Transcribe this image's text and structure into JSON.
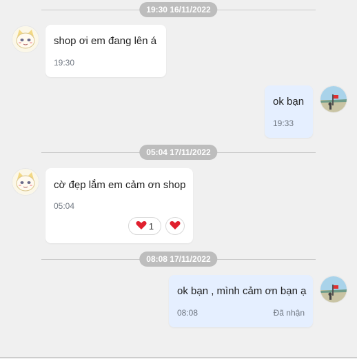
{
  "separators": [
    "19:30 16/11/2022",
    "05:04 17/11/2022",
    "08:08 17/11/2022"
  ],
  "messages": [
    {
      "text": "shop ơi em đang lên á",
      "time": "19:30"
    },
    {
      "text": "ok bạn",
      "time": "19:33"
    },
    {
      "text": "cờ đẹp lắm em cảm ơn shop",
      "time": "05:04",
      "reaction_count": "1"
    },
    {
      "text": "ok bạn , mình cảm ơn bạn ạ",
      "time": "08:08",
      "status": "Đã nhận"
    }
  ],
  "icons": {
    "reaction": "heart-icon"
  },
  "colors": {
    "background": "#f0f0f0",
    "incoming_bubble": "#ffffff",
    "outgoing_bubble": "#e5efff",
    "separator_pill": "#bdbdbd",
    "heart": "#e0202e"
  }
}
